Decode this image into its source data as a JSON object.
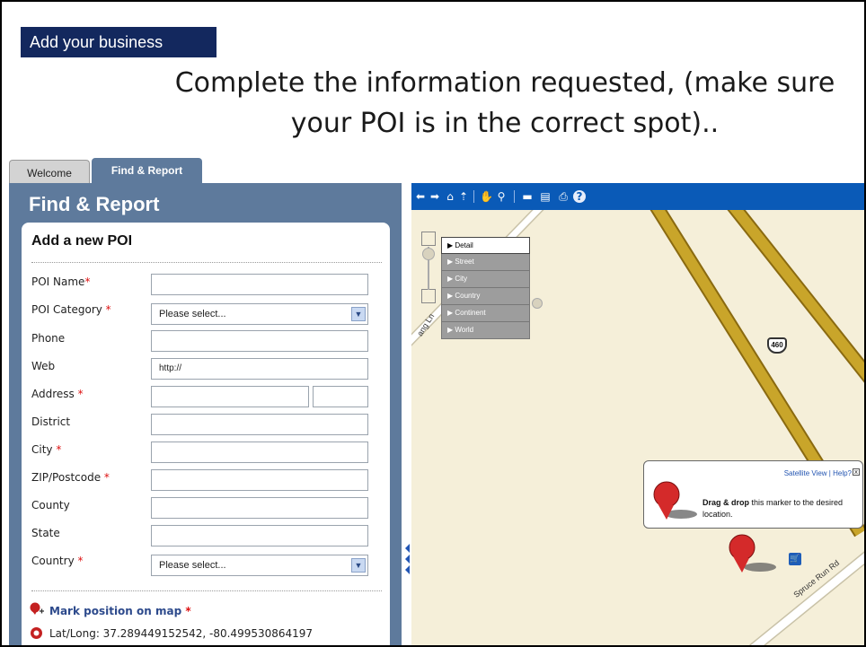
{
  "banner": "Add your business",
  "headline": "Complete the information requested, (make sure your POI is in the correct spot)..",
  "tabs": {
    "welcome": "Welcome",
    "find_report": "Find & Report"
  },
  "panel_title": "Find & Report",
  "form": {
    "title": "Add a new POI",
    "fields": {
      "poi_name": {
        "label": "POI Name",
        "req": "*"
      },
      "poi_category": {
        "label": "POI Category ",
        "req": "*",
        "value": "Please select..."
      },
      "phone": {
        "label": "Phone"
      },
      "web": {
        "label": "Web",
        "value": "http://"
      },
      "address": {
        "label": "Address ",
        "req": "*"
      },
      "district": {
        "label": "District"
      },
      "city": {
        "label": "City ",
        "req": "*"
      },
      "zip": {
        "label": "ZIP/Postcode ",
        "req": "*"
      },
      "county": {
        "label": "County"
      },
      "state": {
        "label": "State"
      },
      "country": {
        "label": "Country ",
        "req": "*",
        "value": "Please select..."
      }
    },
    "mark_position": {
      "label": "Mark position on map",
      "req": "*"
    },
    "latlong": "Lat/Long: 37.289449152542, -80.499530864197"
  },
  "map": {
    "zoom_levels": [
      "Detail",
      "Street",
      "City",
      "Country",
      "Continent",
      "World"
    ],
    "active_zoom": "Detail",
    "popup": {
      "links": "Satellite View | Help?",
      "close": "x",
      "bold": "Drag & drop",
      "text": " this marker to the desired location."
    },
    "route_shield": "460",
    "streets": {
      "spruce": "Spruce Run Rd",
      "lang": "ang Ln"
    }
  },
  "colors": {
    "banner": "#13285e",
    "toolbar": "#0a5ab7",
    "panel": "#5e7a9c",
    "road": "#c9a52a",
    "marker": "#d42a2a"
  }
}
